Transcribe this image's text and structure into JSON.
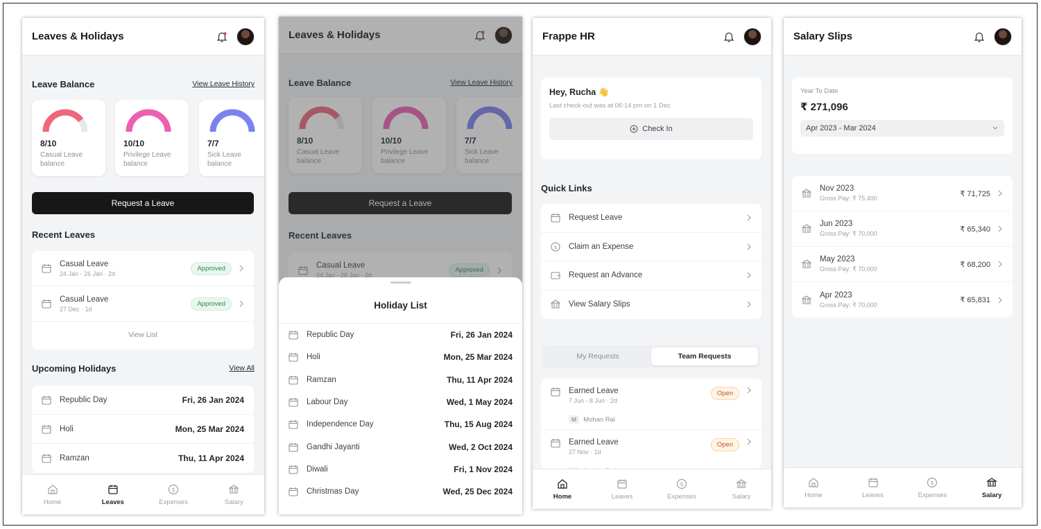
{
  "screen1": {
    "title": "Leaves & Holidays",
    "leave_balance": "Leave Balance",
    "view_leave_history": "View Leave History",
    "balances": [
      {
        "value": "8/10",
        "label1": "Casual Leave",
        "label2": "balance",
        "fraction": 0.8,
        "color": "#f0657a"
      },
      {
        "value": "10/10",
        "label1": "Privilege Leave",
        "label2": "balance",
        "fraction": 1.0,
        "color": "#ec5fb2"
      },
      {
        "value": "7/7",
        "label1": "Sick Leave",
        "label2": "balance",
        "fraction": 1.0,
        "color": "#7b82f0"
      }
    ],
    "request_leave": "Request a Leave",
    "recent_leaves": "Recent Leaves",
    "recent": [
      {
        "title": "Casual Leave",
        "sub": "24 Jan - 26 Jan · 2d",
        "status": "Approved"
      },
      {
        "title": "Casual Leave",
        "sub": "27 Dec · 1d",
        "status": "Approved"
      }
    ],
    "view_list": "View List",
    "upcoming_holidays": "Upcoming Holidays",
    "view_all": "View All",
    "holidays": [
      {
        "name": "Republic Day",
        "date": "Fri, 26 Jan 2024"
      },
      {
        "name": "Holi",
        "date": "Mon, 25 Mar 2024"
      },
      {
        "name": "Ramzan",
        "date": "Thu, 11 Apr 2024"
      }
    ]
  },
  "screen2": {
    "title": "Leaves & Holidays",
    "leave_balance": "Leave Balance",
    "view_leave_history": "View Leave History",
    "request_leave": "Request a Leave",
    "recent_leaves": "Recent Leaves",
    "recent_title": "Casual Leave",
    "recent_sub": "24 Jan - 26 Jan · 2d",
    "recent_status": "Approved",
    "sheet_title": "Holiday List",
    "holidays": [
      {
        "name": "Republic Day",
        "date": "Fri, 26 Jan 2024"
      },
      {
        "name": "Holi",
        "date": "Mon, 25 Mar 2024"
      },
      {
        "name": "Ramzan",
        "date": "Thu, 11 Apr 2024"
      },
      {
        "name": "Labour Day",
        "date": "Wed, 1 May 2024"
      },
      {
        "name": "Independence Day",
        "date": "Thu, 15 Aug 2024"
      },
      {
        "name": "Gandhi Jayanti",
        "date": "Wed, 2 Oct 2024"
      },
      {
        "name": "Diwali",
        "date": "Fri, 1 Nov 2024"
      },
      {
        "name": "Christmas Day",
        "date": "Wed, 25 Dec 2024"
      }
    ]
  },
  "screen3": {
    "title": "Frappe HR",
    "greeting": "Hey, Rucha 👋",
    "last_checkout": "Last check-out was at 06:14 pm on 1 Dec",
    "check_in": "Check In",
    "quick_links": "Quick Links",
    "links": [
      {
        "label": "Request Leave",
        "icon": "calendar-icon"
      },
      {
        "label": "Claim an Expense",
        "icon": "dollar-icon"
      },
      {
        "label": "Request an Advance",
        "icon": "wallet-icon"
      },
      {
        "label": "View Salary Slips",
        "icon": "bank-icon"
      }
    ],
    "tab_my": "My Requests",
    "tab_team": "Team Requests",
    "requests": [
      {
        "title": "Earned Leave",
        "sub": "7 Jun - 8 Jun · 2d",
        "status": "Open",
        "initial": "M",
        "employee": "Mohan Rai"
      },
      {
        "title": "Earned Leave",
        "sub": "27 Nov · 1d",
        "status": "Open",
        "initial": "M",
        "employee": "Mohan Rai"
      }
    ]
  },
  "screen4": {
    "title": "Salary Slips",
    "ytd_label": "Year To Date",
    "ytd_value": "₹ 271,096",
    "period": "Apr 2023 - Mar 2024",
    "slips": [
      {
        "month": "Nov 2023",
        "gross": "Gross Pay: ₹ 75,400",
        "amount": "₹ 71,725"
      },
      {
        "month": "Jun 2023",
        "gross": "Gross Pay: ₹ 70,000",
        "amount": "₹ 65,340"
      },
      {
        "month": "May 2023",
        "gross": "Gross Pay: ₹ 70,000",
        "amount": "₹ 68,200"
      },
      {
        "month": "Apr 2023",
        "gross": "Gross Pay: ₹ 70,000",
        "amount": "₹ 65,831"
      }
    ]
  },
  "tabs": {
    "home": "Home",
    "leaves": "Leaves",
    "expenses": "Expenses",
    "salary": "Salary"
  },
  "colors": {
    "dark_button": "#171717",
    "approved": "#2f855a",
    "open": "#c05621"
  }
}
